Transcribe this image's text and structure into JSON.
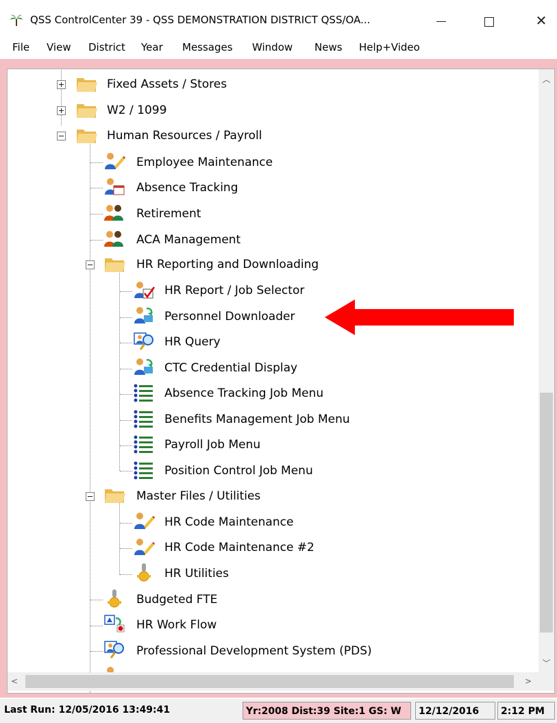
{
  "window": {
    "title": "QSS ControlCenter 39 - QSS DEMONSTRATION DISTRICT QSS/OA...",
    "minimize_icon": "minimize-icon",
    "maximize_icon": "maximize-icon",
    "close_label": "✕"
  },
  "menu": [
    "File",
    "View",
    "District",
    "Year",
    "Messages",
    "Window",
    "News",
    "Help+Video"
  ],
  "tree": {
    "fixed_assets": "Fixed Assets / Stores",
    "w2": "W2 / 1099",
    "hr_payroll": "Human Resources / Payroll",
    "employee_maintenance": "Employee Maintenance",
    "absence_tracking": "Absence Tracking",
    "retirement": "Retirement",
    "aca": "ACA Management",
    "hr_reporting": "HR Reporting and Downloading",
    "hr_report_job": "HR Report / Job Selector",
    "personnel_downloader": "Personnel Downloader",
    "hr_query": "HR Query",
    "ctc_credential": "CTC Credential Display",
    "absence_job_menu": "Absence Tracking Job Menu",
    "benefits_job_menu": "Benefits Management Job Menu",
    "payroll_job_menu": "Payroll Job Menu",
    "position_job_menu": "Position Control Job Menu",
    "master_files": "Master Files / Utilities",
    "hr_code_maint": "HR Code Maintenance",
    "hr_code_maint2": "HR Code Maintenance #2",
    "hr_utilities": "HR Utilities",
    "budgeted_fte": "Budgeted FTE",
    "hr_work_flow": "HR Work Flow",
    "pds": "Professional Development System (PDS)"
  },
  "status": {
    "last_run": "Last Run: 12/05/2016 13:49:41",
    "context": "Yr:2008 Dist:39 Site:1 GS: W",
    "date": "12/12/2016",
    "time": "2:12 PM"
  },
  "colors": {
    "frame": "#f4bfc3",
    "annotation_arrow": "#ff0000",
    "folder": "#f5d27a"
  }
}
